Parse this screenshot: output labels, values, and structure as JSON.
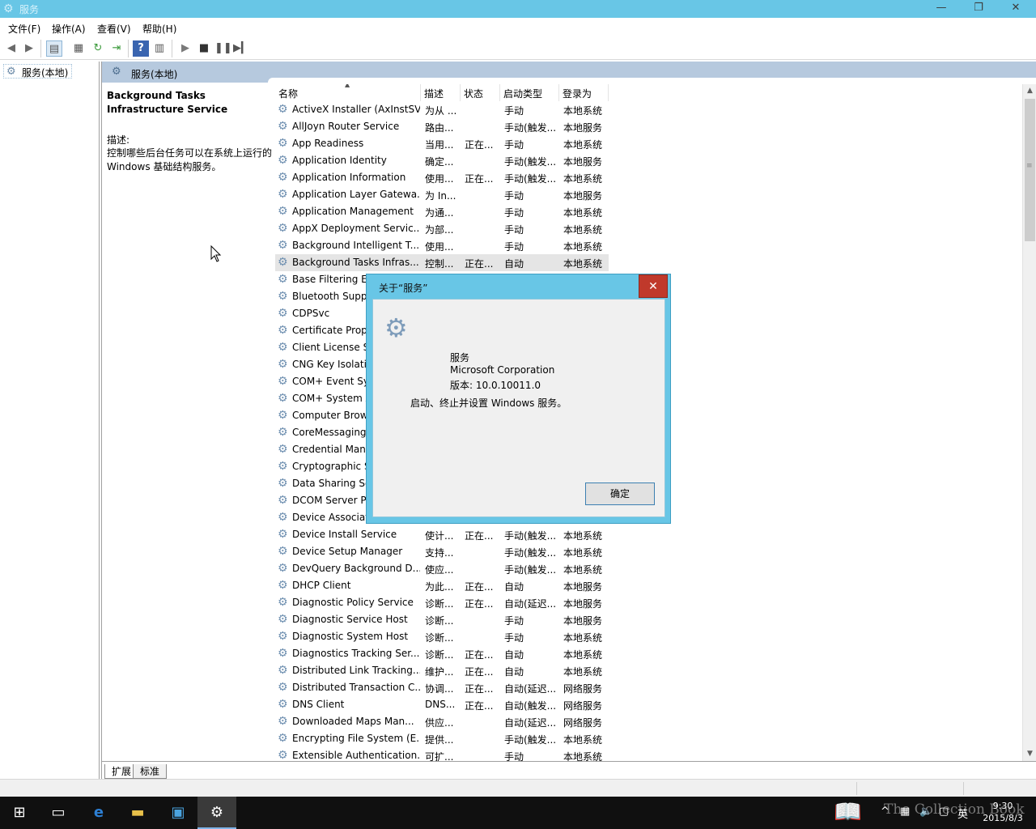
{
  "window": {
    "title": "服务",
    "min_glyph": "—",
    "max_glyph": "❐",
    "close_glyph": "✕"
  },
  "menu": [
    "文件(F)",
    "操作(A)",
    "查看(V)",
    "帮助(H)"
  ],
  "toolbar": {
    "icons": [
      "back-arrow-icon",
      "forward-arrow-icon",
      "show-hide-tree-icon",
      "properties-icon",
      "refresh-icon",
      "export-list-icon",
      "help-icon",
      "view-icon",
      "play-icon",
      "stop-icon",
      "pause-icon",
      "restart-icon"
    ]
  },
  "tree": {
    "root_label": "服务(本地)"
  },
  "main": {
    "header_label": "服务(本地)",
    "selected_title": "Background Tasks Infrastructure Service",
    "desc_label": "描述:",
    "desc_text": "控制哪些后台任务可以在系统上运行的 Windows 基础结构服务。"
  },
  "list": {
    "columns": [
      "名称",
      "描述",
      "状态",
      "启动类型",
      "登录为"
    ],
    "rows": [
      {
        "name": "ActiveX Installer (AxInstSV)",
        "desc": "为从 ...",
        "state": "",
        "start": "手动",
        "logon": "本地系统"
      },
      {
        "name": "AllJoyn Router Service",
        "desc": "路由...",
        "state": "",
        "start": "手动(触发...",
        "logon": "本地服务"
      },
      {
        "name": "App Readiness",
        "desc": "当用...",
        "state": "正在...",
        "start": "手动",
        "logon": "本地系统"
      },
      {
        "name": "Application Identity",
        "desc": "确定...",
        "state": "",
        "start": "手动(触发...",
        "logon": "本地服务"
      },
      {
        "name": "Application Information",
        "desc": "使用...",
        "state": "正在...",
        "start": "手动(触发...",
        "logon": "本地系统"
      },
      {
        "name": "Application Layer Gatewa...",
        "desc": "为 In...",
        "state": "",
        "start": "手动",
        "logon": "本地服务"
      },
      {
        "name": "Application Management",
        "desc": "为通...",
        "state": "",
        "start": "手动",
        "logon": "本地系统"
      },
      {
        "name": "AppX Deployment Servic...",
        "desc": "为部...",
        "state": "",
        "start": "手动",
        "logon": "本地系统"
      },
      {
        "name": "Background Intelligent T...",
        "desc": "使用...",
        "state": "",
        "start": "手动",
        "logon": "本地系统"
      },
      {
        "name": "Background Tasks Infras...",
        "desc": "控制...",
        "state": "正在...",
        "start": "自动",
        "logon": "本地系统",
        "selected": true
      },
      {
        "name": "Base Filtering Engine",
        "desc": "",
        "state": "",
        "start": "",
        "logon": ""
      },
      {
        "name": "Bluetooth Support Service",
        "desc": "",
        "state": "",
        "start": "",
        "logon": ""
      },
      {
        "name": "CDPSvc",
        "desc": "",
        "state": "",
        "start": "",
        "logon": ""
      },
      {
        "name": "Certificate Propagation",
        "desc": "",
        "state": "",
        "start": "",
        "logon": ""
      },
      {
        "name": "Client License Service",
        "desc": "",
        "state": "",
        "start": "",
        "logon": ""
      },
      {
        "name": "CNG Key Isolation",
        "desc": "",
        "state": "",
        "start": "",
        "logon": ""
      },
      {
        "name": "COM+ Event System",
        "desc": "",
        "state": "",
        "start": "",
        "logon": ""
      },
      {
        "name": "COM+ System Application",
        "desc": "",
        "state": "",
        "start": "",
        "logon": ""
      },
      {
        "name": "Computer Browser",
        "desc": "",
        "state": "",
        "start": "",
        "logon": ""
      },
      {
        "name": "CoreMessaging",
        "desc": "",
        "state": "",
        "start": "",
        "logon": ""
      },
      {
        "name": "Credential Manager",
        "desc": "",
        "state": "",
        "start": "",
        "logon": ""
      },
      {
        "name": "Cryptographic Services",
        "desc": "",
        "state": "",
        "start": "",
        "logon": ""
      },
      {
        "name": "Data Sharing Service",
        "desc": "",
        "state": "",
        "start": "",
        "logon": ""
      },
      {
        "name": "DCOM Server Process Launcher",
        "desc": "",
        "state": "",
        "start": "",
        "logon": ""
      },
      {
        "name": "Device Association Service",
        "desc": "",
        "state": "",
        "start": "",
        "logon": ""
      },
      {
        "name": "Device Install Service",
        "desc": "使计...",
        "state": "正在...",
        "start": "手动(触发...",
        "logon": "本地系统"
      },
      {
        "name": "Device Setup Manager",
        "desc": "支持...",
        "state": "",
        "start": "手动(触发...",
        "logon": "本地系统"
      },
      {
        "name": "DevQuery Background D...",
        "desc": "使应...",
        "state": "",
        "start": "手动(触发...",
        "logon": "本地系统"
      },
      {
        "name": "DHCP Client",
        "desc": "为此...",
        "state": "正在...",
        "start": "自动",
        "logon": "本地服务"
      },
      {
        "name": "Diagnostic Policy Service",
        "desc": "诊断...",
        "state": "正在...",
        "start": "自动(延迟...",
        "logon": "本地服务"
      },
      {
        "name": "Diagnostic Service Host",
        "desc": "诊断...",
        "state": "",
        "start": "手动",
        "logon": "本地服务"
      },
      {
        "name": "Diagnostic System Host",
        "desc": "诊断...",
        "state": "",
        "start": "手动",
        "logon": "本地系统"
      },
      {
        "name": "Diagnostics Tracking Ser...",
        "desc": "诊断...",
        "state": "正在...",
        "start": "自动",
        "logon": "本地系统"
      },
      {
        "name": "Distributed Link Tracking...",
        "desc": "维护...",
        "state": "正在...",
        "start": "自动",
        "logon": "本地系统"
      },
      {
        "name": "Distributed Transaction C...",
        "desc": "协调...",
        "state": "正在...",
        "start": "自动(延迟...",
        "logon": "网络服务"
      },
      {
        "name": "DNS Client",
        "desc": "DNS...",
        "state": "正在...",
        "start": "自动(触发...",
        "logon": "网络服务"
      },
      {
        "name": "Downloaded Maps Man...",
        "desc": "供应...",
        "state": "",
        "start": "自动(延迟...",
        "logon": "网络服务"
      },
      {
        "name": "Encrypting File System (E...",
        "desc": "提供...",
        "state": "",
        "start": "手动(触发...",
        "logon": "本地系统"
      },
      {
        "name": "Extensible Authentication...",
        "desc": "可扩...",
        "state": "",
        "start": "手动",
        "logon": "本地系统"
      }
    ]
  },
  "bottom_tabs": [
    "扩展",
    "标准"
  ],
  "dialog": {
    "title": "关于“服务”",
    "close_glyph": "✕",
    "product": "服务",
    "company": "Microsoft Corporation",
    "version": "版本: 10.0.10011.0",
    "message": "启动、终止并设置 Windows 服务。",
    "ok_label": "确定"
  },
  "taskbar": {
    "apps": [
      "windows-start-icon",
      "task-view-icon",
      "edge-icon",
      "file-explorer-icon",
      "store-icon",
      "services-gear-icon"
    ],
    "ime": "英",
    "time": "9:30",
    "date": "2015/8/3",
    "watermark": "The Collection Book"
  }
}
